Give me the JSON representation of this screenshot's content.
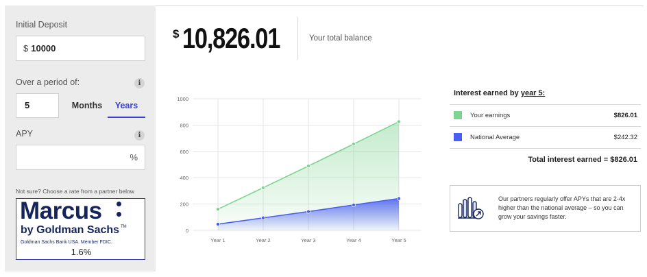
{
  "form": {
    "deposit_label": "Initial Deposit",
    "deposit_currency": "$",
    "deposit_value": "10000",
    "period_label": "Over a period of:",
    "period_value": "5",
    "tab_months": "Months",
    "tab_years": "Years",
    "apy_label": "APY",
    "apy_value": "",
    "apy_unit": "%",
    "info_glyph": "i",
    "partner_hint": "Not sure? Choose a rate from a partner below"
  },
  "partner": {
    "brand": "Marcus",
    "sub_brand": "by Goldman Sachs",
    "trademark": "TM",
    "member_text": "Goldman Sachs Bank USA. Member FDIC.",
    "rate": "1.6%"
  },
  "balance": {
    "currency": "$",
    "amount": "10,826.01",
    "label": "Your total balance"
  },
  "legend": {
    "title_prefix": "Interest earned by ",
    "title_link": "year 5:",
    "earnings_label": "Your earnings",
    "earnings_value": "$826.01",
    "national_label": "National Average",
    "national_value": "$242.32",
    "total_label": "Total interest earned = $826.01"
  },
  "info_card": {
    "text": "Our partners regularly offer APYs that are 2-4x higher than the national average – so you can grow your savings faster.",
    "icon": "bar-chart-arrow-icon"
  },
  "colors": {
    "earnings": "#7dd38f",
    "national": "#4a5ff0",
    "accent": "#3a3fd9",
    "brand": "#15245a"
  },
  "chart_data": {
    "type": "area",
    "categories": [
      "Year 1",
      "Year 2",
      "Year 3",
      "Year 4",
      "Year 5"
    ],
    "series": [
      {
        "name": "Your earnings",
        "values": [
          161,
          324,
          489,
          656,
          826
        ]
      },
      {
        "name": "National Average",
        "values": [
          47,
          95,
          143,
          193,
          242
        ]
      }
    ],
    "yticks": [
      0,
      200,
      400,
      600,
      800,
      1000
    ],
    "ylim": [
      0,
      1000
    ],
    "grid": true
  }
}
